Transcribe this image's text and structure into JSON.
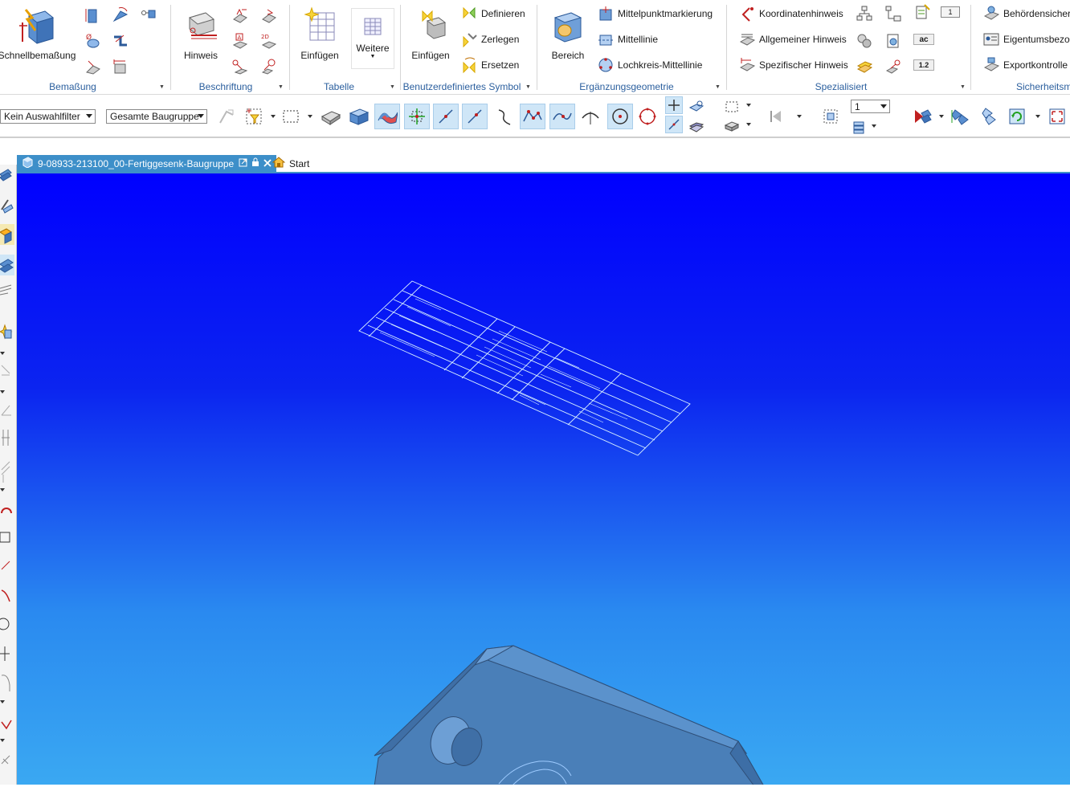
{
  "ribbon": {
    "groups": [
      {
        "label": "Bemaßung",
        "big_button": "Schnellbemaßung"
      },
      {
        "label": "Beschriftung",
        "big_button": "Hinweis"
      },
      {
        "label": "Tabelle",
        "big_buttons": [
          "Einfügen",
          "Weitere"
        ]
      },
      {
        "label": "Benutzerdefiniertes Symbol",
        "big_button": "Einfügen",
        "rows": [
          "Definieren",
          "Zerlegen",
          "Ersetzen"
        ]
      },
      {
        "label": "Ergänzungsgeometrie",
        "big_button": "Bereich",
        "rows": [
          "Mittelpunktmarkierung",
          "Mittellinie",
          "Lochkreis-Mittellinie"
        ]
      },
      {
        "label": "Spezialisiert",
        "rows": [
          "Koordinatenhinweis",
          "Allgemeiner Hinweis",
          "Spezifischer Hinweis"
        ],
        "badges": [
          "1",
          "ac",
          "1.2"
        ]
      },
      {
        "label": "Sicherheitsma",
        "rows": [
          "Behördensicher",
          "Eigentumsbezo",
          "Exportkontrolle"
        ]
      }
    ]
  },
  "toolbar": {
    "filter_select": "Kein Auswahlfilter",
    "scope_select": "Gesamte Baugruppe",
    "layer_select": "1"
  },
  "tabs": {
    "document": "9-08933-213100_00-Fertiggesenk-Baugruppe",
    "start": "Start"
  },
  "colors": {
    "accent": "#3d8fc9",
    "group_label": "#2b5f9e",
    "viewport_top": "#0000ff",
    "viewport_bottom": "#3aa8f2",
    "table_lines": "#d8f0ff",
    "part_fill": "#4a7fb8"
  }
}
